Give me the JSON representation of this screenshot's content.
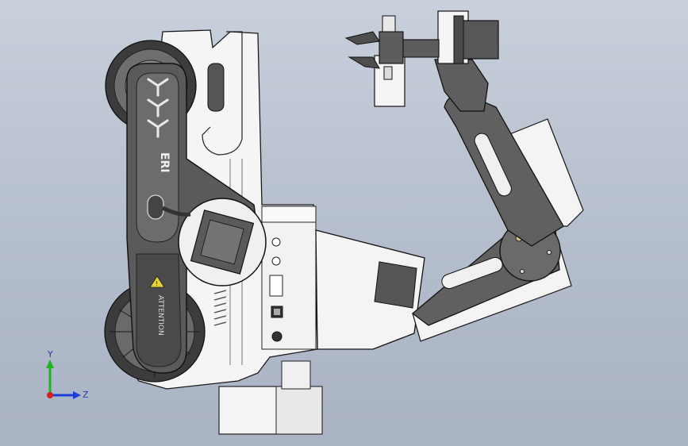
{
  "viewport": {
    "background_top": "#c9d0dc",
    "background_bottom": "#aab3c4"
  },
  "model": {
    "brand_mark": "ERI",
    "warning_label": "ATTENTION"
  },
  "triad": {
    "axis_y": "Y",
    "axis_z": "Z",
    "colors": {
      "y": "#1fb31f",
      "z": "#1e3fd6",
      "x": "#d41f1f"
    }
  },
  "icons": [
    "warning-triangle-icon",
    "chevron-y-icon"
  ]
}
